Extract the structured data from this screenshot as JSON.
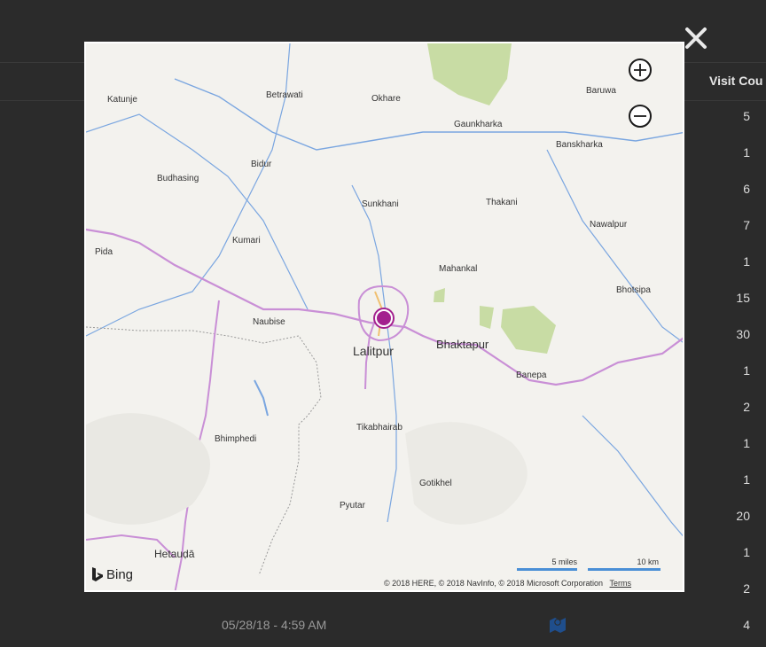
{
  "table": {
    "column_header": "Visit Cou",
    "visit_counts": [
      "5",
      "1",
      "6",
      "7",
      "1",
      "15",
      "30",
      "1",
      "2",
      "1",
      "1",
      "20",
      "1",
      "2",
      "4"
    ],
    "last_row_date": "05/28/18 - 4:59 AM",
    "map_icon": "map-icon"
  },
  "modal": {
    "close_icon": "close-icon",
    "zoom_in_icon": "plus-icon",
    "zoom_out_icon": "minus-icon",
    "provider": "Bing",
    "scale_miles": "5 miles",
    "scale_km": "10 km",
    "copyright": "© 2018 HERE, © 2018 NavInfo, © 2018 Microsoft Corporation",
    "terms": "Terms",
    "places": [
      "Katunje",
      "Betrawati",
      "Okhare",
      "Baruwa",
      "Gaunkharka",
      "Banskharka",
      "Bidur",
      "Budhasing",
      "Sunkhani",
      "Thakani",
      "Nawalpur",
      "Kumari",
      "Pida",
      "Mahankal",
      "Bhotsipa",
      "Naubise",
      "Lalitpur",
      "Bhaktapur",
      "Banepa",
      "Tikabhairab",
      "Bhimphedi",
      "Gotikhel",
      "Pyutar",
      "Hetauḍā"
    ]
  },
  "colors": {
    "pin": "#a3218e",
    "scale_bar": "#4a8fd6",
    "border_road": "#c98fd6",
    "river": "#7aa6e0"
  }
}
